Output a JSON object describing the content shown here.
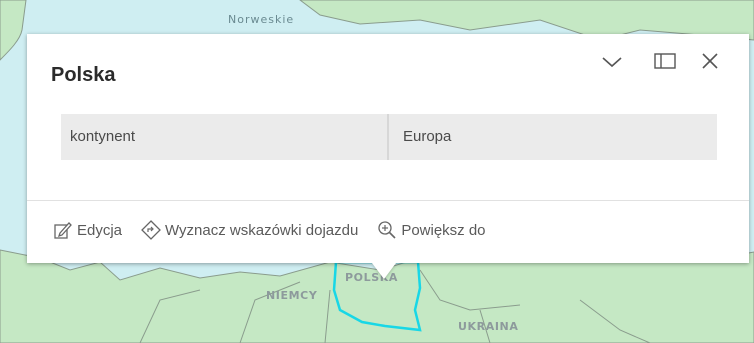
{
  "map": {
    "labels": {
      "sea": "Norweskie",
      "country_pl": "POLSKA",
      "country_de": "NIEMCY",
      "country_ua": "UKRAINA"
    },
    "colors": {
      "water": "#cfeef2",
      "land": "#c5e8c4",
      "border": "#8a9c8d",
      "selection": "#18d7e6"
    }
  },
  "popup": {
    "title": "Polska",
    "attributes": [
      {
        "key": "kontynent",
        "value": "Europa"
      }
    ],
    "actions": {
      "edit": "Edycja",
      "directions": "Wyznacz wskazówki dojazdu",
      "zoom_to": "Powiększ do"
    },
    "header_icons": [
      "chevron-down-icon",
      "dock-icon",
      "close-icon"
    ]
  }
}
